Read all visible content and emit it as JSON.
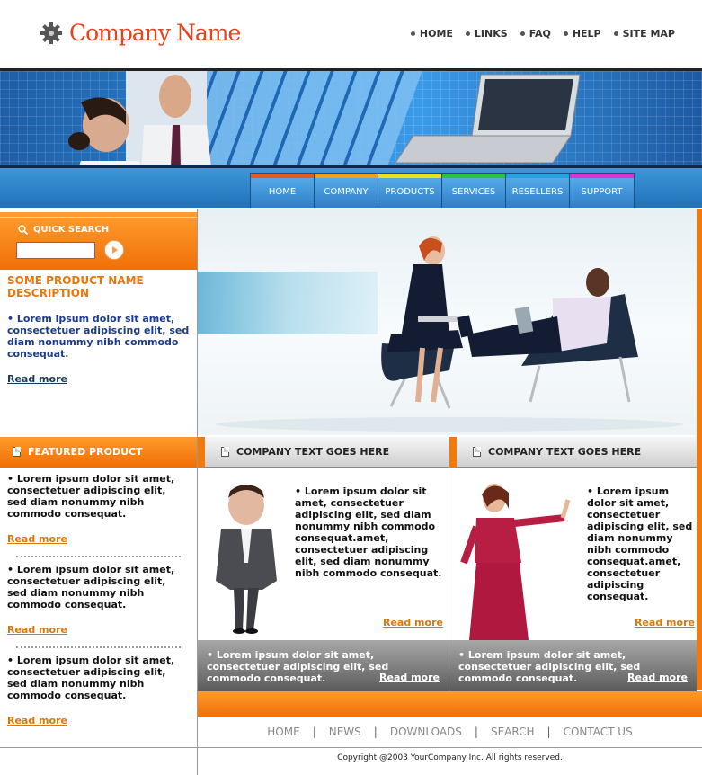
{
  "brand": {
    "name": "Company Name"
  },
  "topnav": [
    "HOME",
    "LINKS",
    "FAQ",
    "HELP",
    "SITE MAP"
  ],
  "mainnav": [
    {
      "label": "HOME",
      "color": "#e85a1a"
    },
    {
      "label": "COMPANY",
      "color": "#f0a020"
    },
    {
      "label": "PRODUCTS",
      "color": "#e8e020"
    },
    {
      "label": "SERVICES",
      "color": "#30c040"
    },
    {
      "label": "RESELLERS",
      "color": "#2aa0e0"
    },
    {
      "label": "SUPPORT",
      "color": "#e030d0"
    }
  ],
  "quick_search": {
    "title": "QUICK SEARCH",
    "value": ""
  },
  "product": {
    "name": "SOME PRODUCT NAME DESCRIPTION",
    "text": "Lorem ipsum dolor sit amet, consectetuer adipiscing elit, sed diam nonummy nibh commodo consequat.",
    "read_more": "Read more"
  },
  "featured": {
    "title": "FEATURED PRODUCT",
    "items": [
      {
        "text": "Lorem ipsum dolor sit amet, consectetuer adipiscing elit, sed diam nonummy nibh commodo consequat.",
        "read_more": "Read more"
      },
      {
        "text": "Lorem ipsum dolor sit amet, consectetuer adipiscing elit, sed diam nonummy nibh commodo consequat.",
        "read_more": "Read more"
      },
      {
        "text": "Lorem ipsum dolor sit amet, consectetuer adipiscing elit, sed diam nonummy nibh commodo consequat.",
        "read_more": "Read more"
      }
    ]
  },
  "company_boxes": [
    {
      "title": "COMPANY TEXT GOES HERE",
      "text": "Lorem ipsum dolor sit amet, consectetuer adipiscing elit, sed diam nonummy nibh commodo consequat.amet, consectetuer adipiscing elit, sed diam nonummy nibh commodo consequat.",
      "read_more": "Read more",
      "footer_text": "Lorem ipsum dolor sit amet, consectetuer adipiscing elit, sed commodo consequat.",
      "footer_read_more": "Read more"
    },
    {
      "title": "COMPANY TEXT GOES HERE",
      "text": "Lorem ipsum dolor sit amet, consectetuer adipiscing elit, sed diam nonummy nibh commodo consequat.amet, consectetuer adipiscing consequat.",
      "read_more": "Read more",
      "footer_text": "Lorem ipsum dolor sit amet, consectetuer adipiscing elit, sed commodo consequat.",
      "footer_read_more": "Read more"
    }
  ],
  "bottomnav": [
    "HOME",
    "NEWS",
    "DOWNLOADS",
    "SEARCH",
    "CONTACT US"
  ],
  "copyright": "Copyright @2003 YourCompany Inc. All rights reserved."
}
